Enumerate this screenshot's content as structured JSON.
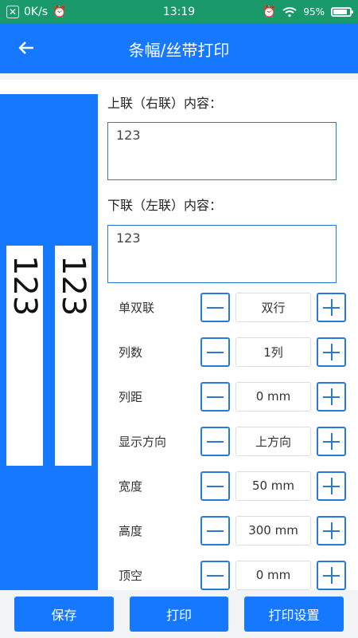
{
  "status_bar": {
    "network_speed": "0K/s",
    "time": "13:19",
    "battery": "95%",
    "battery_level": 0.95
  },
  "header": {
    "title": "条幅/丝带打印"
  },
  "preview": {
    "left_text": "123",
    "right_text": "123"
  },
  "form": {
    "upper_label": "上联（右联）内容：",
    "upper_value": "123",
    "lower_label": "下联（左联）内容：",
    "lower_value": "123",
    "rows": [
      {
        "label": "单双联",
        "value": "双行"
      },
      {
        "label": "列数",
        "value": "1列"
      },
      {
        "label": "列距",
        "value": "0 mm"
      },
      {
        "label": "显示方向",
        "value": "上方向"
      },
      {
        "label": "宽度",
        "value": "50 mm"
      },
      {
        "label": "高度",
        "value": "300 mm"
      },
      {
        "label": "顶空",
        "value": "0 mm"
      }
    ]
  },
  "footer": {
    "save": "保存",
    "print": "打印",
    "print_settings": "打印设置"
  },
  "colors": {
    "status_bar": "#1a9a6a",
    "primary": "#1677ff",
    "border": "#2b79d6"
  },
  "icons": {
    "back": "arrow-left-icon",
    "minus": "minus-icon",
    "plus": "plus-icon",
    "alarm": "alarm-icon",
    "wifi": "wifi-icon",
    "battery": "battery-icon"
  }
}
